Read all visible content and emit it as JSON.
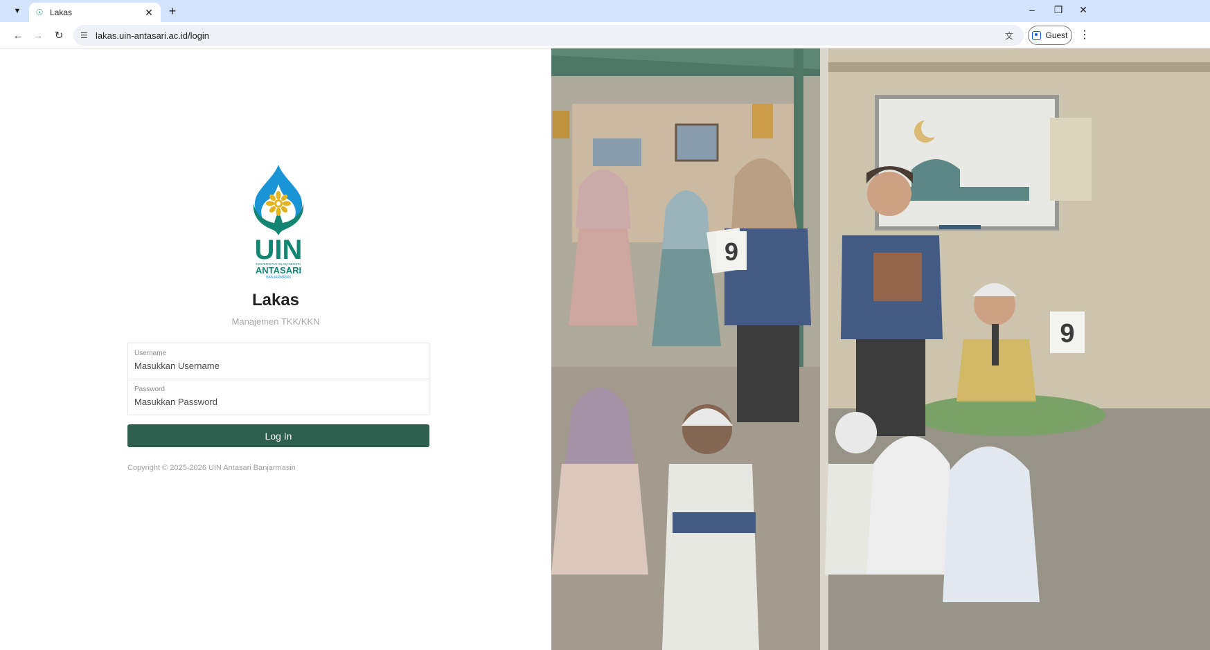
{
  "browser": {
    "tab_title": "Lakas",
    "url": "lakas.uin-antasari.ac.id/login",
    "profile_label": "Guest"
  },
  "logo": {
    "line1": "UIN",
    "line2": "UNIVERSITAS ISLAM NEGERI",
    "line3": "ANTASARI",
    "line4": "BANJARMASIN"
  },
  "app": {
    "title": "Lakas",
    "subtitle": "Manajemen TKK/KKN"
  },
  "form": {
    "username_label": "Username",
    "username_placeholder": "Masukkan Username",
    "password_label": "Password",
    "password_placeholder": "Masukkan Password",
    "login_label": "Log In"
  },
  "footer": {
    "copyright": "Copyright © 2025-2026 UIN Antasari Banjarmasin"
  },
  "colors": {
    "brand_green": "#2e5e4e",
    "logo_teal": "#138573",
    "logo_blue": "#1b94d6",
    "logo_gold": "#e2b420"
  }
}
